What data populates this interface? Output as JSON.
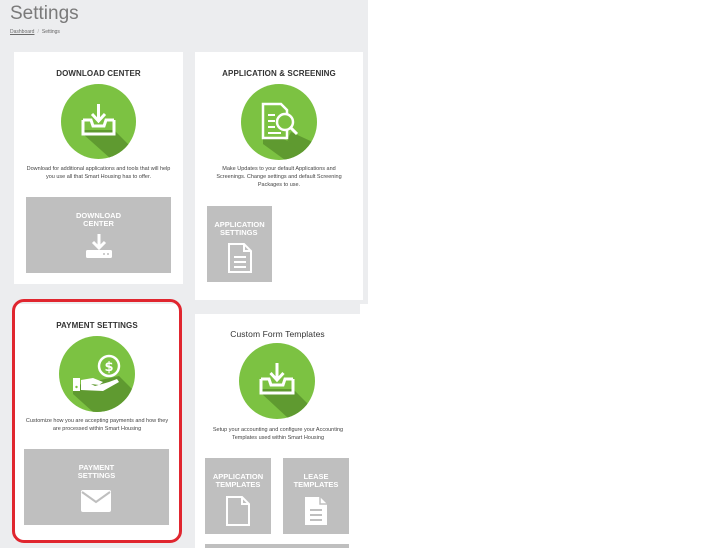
{
  "page": {
    "title": "Settings",
    "breadcrumb": {
      "home": "Dashboard",
      "current": "Settings"
    }
  },
  "cards": {
    "download_center": {
      "title": "DOWNLOAD CENTER",
      "description": "Download for additional applications and tools that will help you use all that Smart Housing has to offer.",
      "tile_label_line1": "DOWNLOAD",
      "tile_label_line2": "CENTER",
      "icon": "inbox-download-icon"
    },
    "application_screening": {
      "title": "APPLICATION & SCREENING",
      "description": "Make Updates to your default Applications and Screenings. Change settings and default Screening Packages to use.",
      "tile_label_line1": "APPLICATION",
      "tile_label_line2": "SETTINGS",
      "icon": "document-search-icon"
    },
    "payment_settings": {
      "title": "PAYMENT SETTINGS",
      "description": "Customize how you are accepting payments and how they are processed within Smart Housing",
      "tile_label_line1": "PAYMENT",
      "tile_label_line2": "SETTINGS",
      "icon": "hand-coin-icon"
    },
    "custom_form_templates": {
      "title": "Custom Form Templates",
      "description": "Setup your accounting and configure your Accounting Templates used within Smart Housing",
      "tiles": [
        {
          "line1": "APPLICATION",
          "line2": "TEMPLATES"
        },
        {
          "line1": "LEASE",
          "line2": "TEMPLATES"
        }
      ],
      "icon": "inbox-download-icon"
    }
  },
  "colors": {
    "accent_green": "#7cc242",
    "shadow_green": "#5f9a30",
    "tile_gray": "#bfbfbf",
    "highlight_red": "#e0262f"
  }
}
